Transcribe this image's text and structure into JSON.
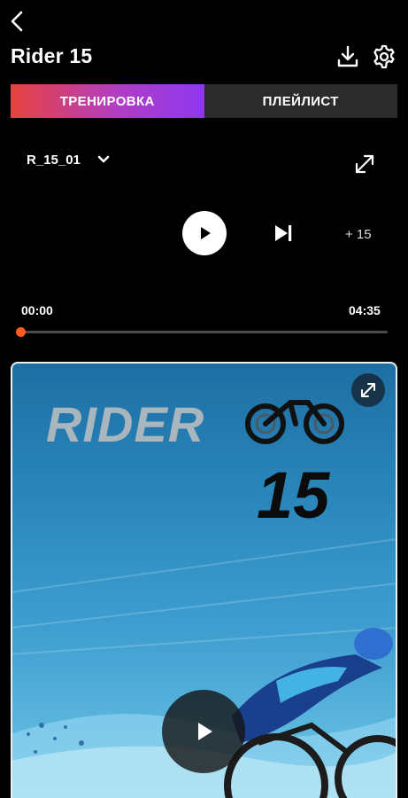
{
  "header": {
    "title": "Rider 15"
  },
  "tabs": [
    {
      "label": "ТРЕНИРОВКА",
      "active": true
    },
    {
      "label": "ПЛЕЙЛИСТ",
      "active": false
    }
  ],
  "player": {
    "track_name": "R_15_01",
    "skip_label": "+ 15",
    "time_start": "00:00",
    "time_end": "04:35",
    "progress": 0.0
  },
  "video": {
    "poster_title": "RIDER",
    "poster_number": "15"
  },
  "colors": {
    "accent_orange": "#ff5a1f",
    "tab_gradient_start": "#e8423d",
    "tab_gradient_end": "#8e37f0"
  }
}
